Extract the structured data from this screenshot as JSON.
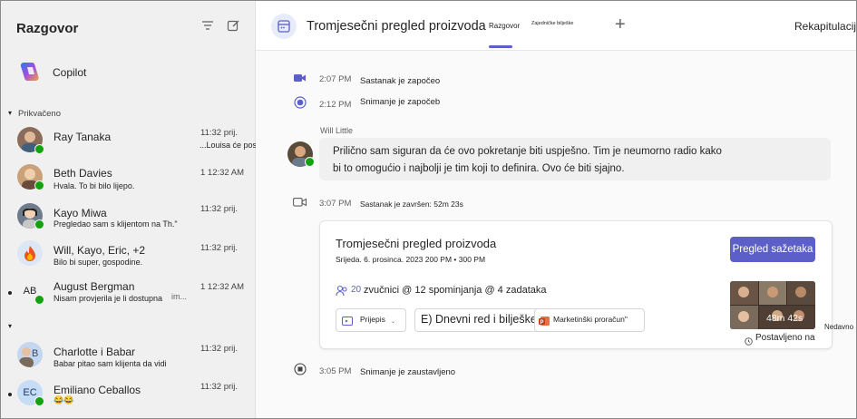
{
  "sidebar": {
    "title": "Razgovor",
    "copilot_label": "Copilot",
    "pinned_label": "Prikvačeno",
    "chats": [
      {
        "name": "Ray Tanaka",
        "time": "11:32 prij.",
        "preview": "...Louisa će poslati početni popis"
      },
      {
        "name": "Beth Davies",
        "time": "1 12:32 AM",
        "preview": "Hvala. To bi bilo lijepo."
      },
      {
        "name": "Kayo Miwa",
        "time": "11:32 prij.",
        "preview": "Pregledao sam s klijentom na Th.\""
      },
      {
        "name": "Will, Kayo, Eric, +2",
        "time": "11:32 prij.",
        "preview": "Bilo bi super, gospodine."
      },
      {
        "name": "August Bergman",
        "time": "1 12:32 AM",
        "preview": "Nisam provjerila je li dostupna",
        "initials": "AB",
        "extra": "im..."
      },
      {
        "name": "Charlotte i Babar",
        "time": "11:32 prij.",
        "preview": "Babar pitao sam klijenta da vidi",
        "initials": "B"
      },
      {
        "name": "Emiliano Ceballos",
        "time": "11:32 prij.",
        "preview": "😂😂",
        "initials": "EC"
      }
    ]
  },
  "header": {
    "title": "Tromjesečni pregled proizvoda",
    "tab_chat": "Razgovor",
    "tab_notes": "Zajedničke bilješke",
    "recap": "Rekapitulacija"
  },
  "events": {
    "meeting_started": {
      "time": "2:07 PM",
      "text": "Sastanak je započeo"
    },
    "recording_started": {
      "time": "2:12 PM",
      "text": "Snimanje je započeb"
    },
    "message": {
      "author": "Will Little",
      "line1": "Prilično sam siguran da će ovo pokretanje biti uspješno. Tim je neumorno radio kako",
      "line2": "bi to omogućio i najbolji je tim koji to definira. Ovo će biti sjajno."
    },
    "meeting_ended": {
      "time": "3:07 PM",
      "text": "Sastanak je završen: 52m 23s"
    },
    "recording_stopped": {
      "time": "3:05 PM",
      "text": "Snimanje je zaustavljeno"
    }
  },
  "card": {
    "title": "Tromjesečni pregled proizvoda",
    "date": "Srijeda. 6. prosinca. 2023 200 PM • 300 PM",
    "button": "Pregled sažetaka",
    "stats_prefix": "20",
    "stats": "zvučnici @ 12 spominjanja @ 4 zadataka",
    "chip_transcript": "Prijepis",
    "chip_agenda": "E) Dnevni red i bilješke",
    "chip_budget": "Marketinški proračun\"",
    "duration": "48m 42s",
    "posted": "Postavljeno na",
    "recent": "Nedavno"
  },
  "colors": {
    "accent": "#5b5fc7",
    "presence": "#13a10e"
  }
}
